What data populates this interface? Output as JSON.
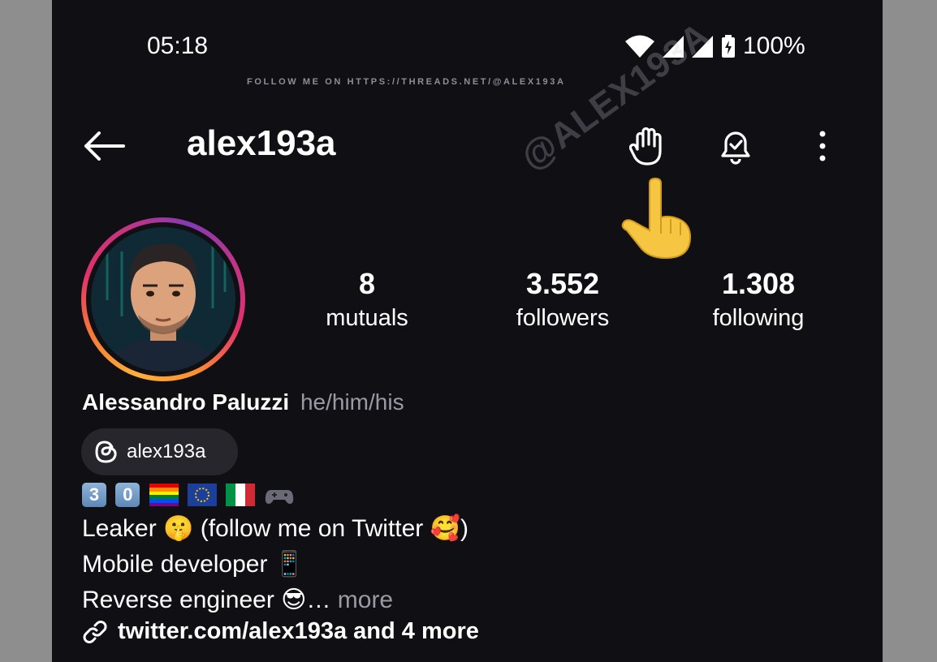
{
  "status_bar": {
    "time": "05:18",
    "battery": "100%"
  },
  "watermark": {
    "top_text": "FOLLOW ME ON HTTPS://THREADS.NET/@ALEX193A",
    "diagonal_text": "@ALEX193A"
  },
  "header": {
    "username": "alex193a"
  },
  "stats": [
    {
      "value": "8",
      "label": "mutuals"
    },
    {
      "value": "3.552",
      "label": "followers"
    },
    {
      "value": "1.308",
      "label": "following"
    }
  ],
  "profile": {
    "full_name": "Alessandro Paluzzi",
    "pronouns": "he/him/his",
    "threads_handle": "alex193a",
    "emoji_row": "3️⃣0️⃣🏳️‍🌈🇪🇺🇮🇹🎮",
    "bio": {
      "line1": "Leaker 🤫 (follow me on Twitter 🥰)",
      "line2": "Mobile developer 📱",
      "line3": "Reverse engineer 😎…",
      "more": "more"
    },
    "link": "twitter.com/alex193a and 4 more"
  },
  "icons": {
    "back": "arrow-left-icon",
    "wave": "hand-wave-icon",
    "bell": "bell-check-icon",
    "menu": "more-vertical-icon",
    "threads": "threads-logo-icon",
    "link": "link-icon",
    "pointer": "pointing-hand-emoji"
  }
}
